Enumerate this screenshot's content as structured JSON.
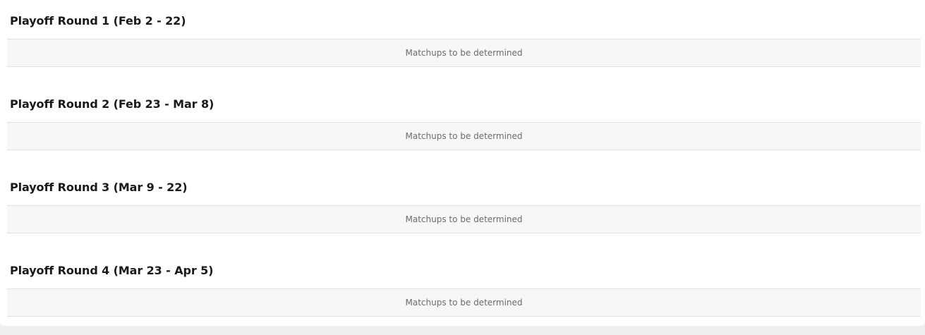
{
  "rounds": [
    {
      "title": "Playoff Round 1 (Feb 2 - 22)",
      "status": "Matchups to be determined"
    },
    {
      "title": "Playoff Round 2 (Feb 23 - Mar 8)",
      "status": "Matchups to be determined"
    },
    {
      "title": "Playoff Round 3 (Mar 9 - 22)",
      "status": "Matchups to be determined"
    },
    {
      "title": "Playoff Round 4 (Mar 23 - Apr 5)",
      "status": "Matchups to be determined"
    }
  ]
}
